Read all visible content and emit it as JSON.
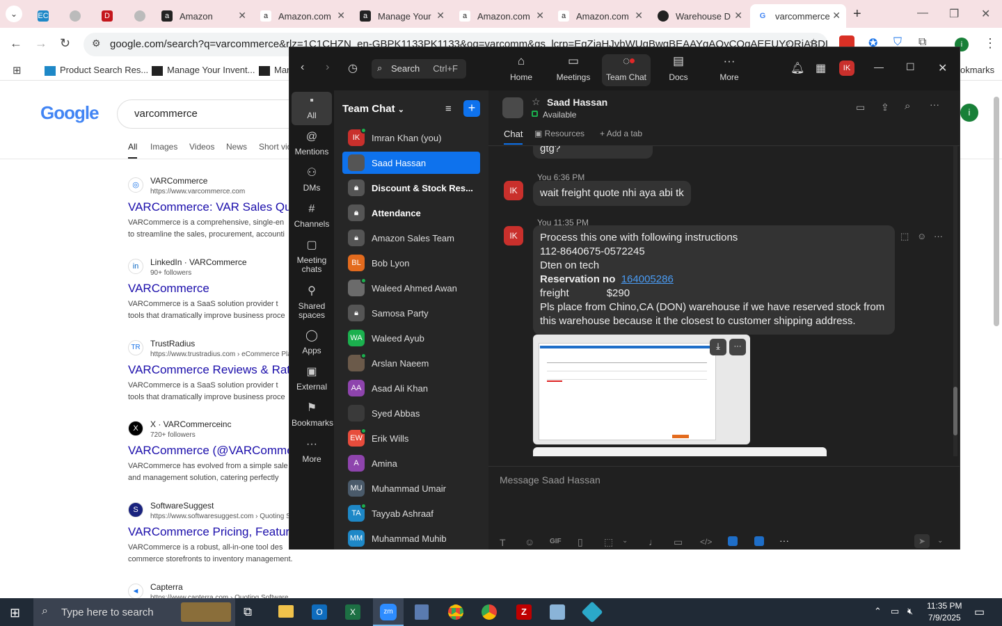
{
  "browser": {
    "tabs": [
      {
        "label": "",
        "icon": "ec-icon"
      },
      {
        "label": "",
        "icon": "globe-icon"
      },
      {
        "label": "",
        "icon": "dwh-icon"
      },
      {
        "label": "",
        "icon": "globe-icon"
      },
      {
        "label": "Amazon",
        "icon": "amazon-icon"
      },
      {
        "label": "Amazon.com",
        "icon": "amazon-icon"
      },
      {
        "label": "Manage Your",
        "icon": "amazon-icon"
      },
      {
        "label": "Amazon.com",
        "icon": "amazon-icon"
      },
      {
        "label": "Amazon.com",
        "icon": "amazon-icon"
      },
      {
        "label": "Warehouse D",
        "icon": "warehouse-icon"
      },
      {
        "label": "varcommerce",
        "icon": "google-icon"
      }
    ],
    "url": "google.com/search?q=varcommerce&rlz=1C1CHZN_en-GBPK1133PK1133&oq=varcomm&gs_lcrp=EgZjaHJvbWUqBwgBEAAYgAQyCQgAEEUYORiABDIH...",
    "bookmarks": [
      "Product Search Res...",
      "Manage Your Invent...",
      "Mar",
      "okmarks"
    ]
  },
  "google": {
    "logo": "Google",
    "query": "varcommerce",
    "tabs": [
      "All",
      "Images",
      "Videos",
      "News",
      "Short vid"
    ],
    "results": [
      {
        "icon": "◎",
        "site": "VARCommerce",
        "url": "https://www.varcommerce.com",
        "title": "VARCommerce: VAR Sales Quo",
        "snippet1": "VARCommerce is a comprehensive, single-en",
        "snippet2": "to streamline the sales, procurement, accounti"
      },
      {
        "icon": "in",
        "site": "LinkedIn · VARCommerce",
        "url": "90+ followers",
        "title": "VARCommerce",
        "snippet1": "VARCommerce is a SaaS solution provider t",
        "snippet2": "tools that dramatically improve business proce"
      },
      {
        "icon": "TR",
        "site": "TrustRadius",
        "url": "https://www.trustradius.com › eCommerce Plat",
        "title": "VARCommerce Reviews & Ratin",
        "snippet1": "VARCommerce is a SaaS solution provider t",
        "snippet2": "tools that dramatically improve business proce"
      },
      {
        "icon": "X",
        "site": "X · VARCommerceinc",
        "url": "720+ followers",
        "title": "VARCommerce (@VARCommer",
        "snippet1": "VARCommerce has evolved from a simple sale",
        "snippet2": "and management solution, catering perfectly"
      },
      {
        "icon": "S",
        "site": "SoftwareSuggest",
        "url": "https://www.softwaresuggest.com › Quoting So",
        "title": "VARCommerce Pricing, Feature",
        "snippet1": "VARCommerce is a robust, all-in-one tool des",
        "snippet2": "commerce storefronts to inventory management."
      },
      {
        "icon": "◄",
        "site": "Capterra",
        "url": "https://www.capterra.com › Quoting Software",
        "title": "",
        "snippet1": "",
        "snippet2": ""
      }
    ]
  },
  "zoom": {
    "search_label": "Search",
    "search_shortcut": "Ctrl+F",
    "top_tabs": [
      {
        "label": "Home",
        "icon": "⌂"
      },
      {
        "label": "Meetings",
        "icon": "▭"
      },
      {
        "label": "Team Chat",
        "icon": "◌"
      },
      {
        "label": "Docs",
        "icon": "▤"
      },
      {
        "label": "More",
        "icon": "···"
      }
    ],
    "user_initials": "IK",
    "rail": [
      {
        "label": "All",
        "icon": "▪"
      },
      {
        "label": "Mentions",
        "icon": "@"
      },
      {
        "label": "DMs",
        "icon": "⚇"
      },
      {
        "label": "Channels",
        "icon": "#"
      },
      {
        "label": "Meeting chats",
        "icon": "▢"
      },
      {
        "label": "Shared spaces",
        "icon": "⚲"
      },
      {
        "label": "Apps",
        "icon": "◯"
      },
      {
        "label": "External",
        "icon": "▣"
      },
      {
        "label": "Bookmarks",
        "icon": "⚑"
      },
      {
        "label": "More",
        "icon": "···"
      }
    ],
    "list_title": "Team Chat",
    "chats": [
      {
        "name": "Imran Khan (you)",
        "initials": "IK",
        "color": "#c9302c",
        "bold": false,
        "lock": false
      },
      {
        "name": "Saad Hassan",
        "initials": "",
        "color": "#555555",
        "bold": false,
        "lock": false
      },
      {
        "name": "Discount & Stock Res...",
        "initials": "",
        "color": "#555555",
        "bold": true,
        "lock": true
      },
      {
        "name": "Attendance",
        "initials": "",
        "color": "#555555",
        "bold": true,
        "lock": true
      },
      {
        "name": "Amazon Sales Team",
        "initials": "",
        "color": "#555555",
        "bold": false,
        "lock": true
      },
      {
        "name": "Bob Lyon",
        "initials": "BL",
        "color": "#e36b1e",
        "bold": false,
        "lock": false
      },
      {
        "name": "Waleed Ahmed Awan",
        "initials": "",
        "color": "#6b6b6b",
        "bold": false,
        "lock": false
      },
      {
        "name": "Samosa Party",
        "initials": "",
        "color": "#555555",
        "bold": false,
        "lock": true
      },
      {
        "name": "Waleed Ayub",
        "initials": "WA",
        "color": "#1bb04e",
        "bold": false,
        "lock": false
      },
      {
        "name": "Arslan Naeem",
        "initials": "",
        "color": "#6b5a4a",
        "bold": false,
        "lock": false
      },
      {
        "name": "Asad Ali Khan",
        "initials": "AA",
        "color": "#8e44ad",
        "bold": false,
        "lock": false
      },
      {
        "name": "Syed Abbas",
        "initials": "",
        "color": "#3a3a3a",
        "bold": false,
        "lock": false
      },
      {
        "name": "Erik Wills",
        "initials": "EW",
        "color": "#e74c3c",
        "bold": false,
        "lock": false
      },
      {
        "name": "Amina",
        "initials": "A",
        "color": "#8e44ad",
        "bold": false,
        "lock": false
      },
      {
        "name": "Muhammad Umair",
        "initials": "MU",
        "color": "#4a5a6a",
        "bold": false,
        "lock": false
      },
      {
        "name": "Tayyab Ashraaf",
        "initials": "TA",
        "color": "#1e88c7",
        "bold": false,
        "lock": false
      },
      {
        "name": "Muhammad Muhib",
        "initials": "MM",
        "color": "#1e88c7",
        "bold": false,
        "lock": false
      }
    ],
    "contact": {
      "name": "Saad Hassan",
      "status": "Available"
    },
    "chat_tabs": [
      "Chat",
      "Resources",
      "Add a tab"
    ],
    "messages": {
      "prev_bubble": "gtg?",
      "m1_meta": "You 6:36 PM",
      "m1_text": "wait freight quote nhi aya abi tk",
      "m2_meta": "You 11:35 PM",
      "m2_line1": "Process this one with following instructions",
      "m2_line2": "112-8640675-0572245",
      "m2_line3": "Dten on tech",
      "m2_res_label": "Reservation no",
      "m2_res_link": "164005286",
      "m2_freight_label": "freight",
      "m2_freight_value": "$290",
      "m2_line6": "Pls place from   Chino,CA (DON) warehouse  if we have reserved stock from",
      "m2_line7": "this warehouse because it the closest to customer shipping address."
    },
    "composer_placeholder": "Message Saad Hassan"
  },
  "taskbar": {
    "search_placeholder": "Type here to search",
    "time": "11:35 PM",
    "date": "7/9/2025"
  }
}
